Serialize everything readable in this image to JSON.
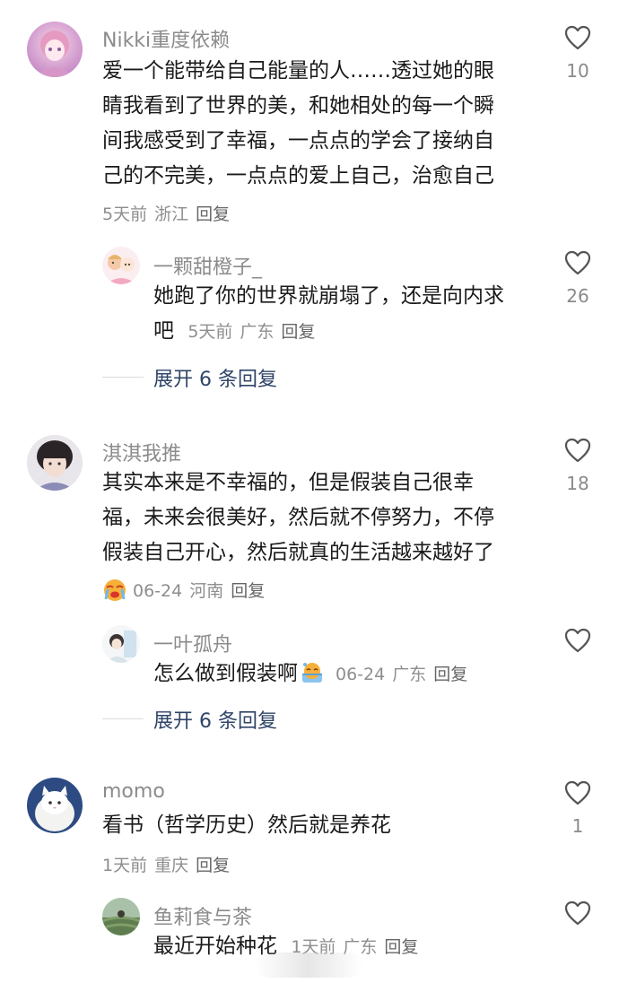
{
  "comments": [
    {
      "username": "Nikki重度依赖",
      "lines": [
        "爱一个能带给自己能量的人……透过她的眼",
        "睛我看到了世界的美，和她相处的每一个瞬",
        "间我感受到了幸福，一点点的学会了接纳自",
        "己的不完美，一点点的爱上自己，治愈自己"
      ],
      "time": "5天前",
      "location": "浙江",
      "reply_label": "回复",
      "likes": "10",
      "reply": {
        "username": "一颗甜橙子_",
        "lines": [
          "她跑了你的世界就崩塌了，还是向内求",
          "吧"
        ],
        "time": "5天前",
        "location": "广东",
        "reply_label": "回复",
        "likes": "26"
      },
      "expand_label": "展开 6 条回复"
    },
    {
      "username": "淇淇我推",
      "lines": [
        "其实本来是不幸福的，但是假装自己很幸",
        "福，未来会很美好，然后就不停努力，不停",
        "假装自己开心，然后就真的生活越来越好了"
      ],
      "time": "06-24",
      "location": "河南",
      "reply_label": "回复",
      "likes": "18",
      "reply": {
        "username": "一叶孤舟",
        "text": "怎么做到假装啊",
        "time": "06-24",
        "location": "广东",
        "reply_label": "回复",
        "likes": ""
      },
      "expand_label": "展开 6 条回复"
    },
    {
      "username": "momo",
      "lines": [
        "看书（哲学历史）然后就是养花"
      ],
      "time": "1天前",
      "location": "重庆",
      "reply_label": "回复",
      "likes": "1",
      "reply": {
        "username": "鱼莉食与茶",
        "text": "最近开始种花",
        "time": "1天前",
        "location": "广东",
        "reply_label": "回复",
        "likes": ""
      }
    }
  ],
  "icons": {
    "like": "heart-outline-icon",
    "emoji_cry": "crying-face-emoji",
    "emoji_sweat": "sweating-face-emoji"
  },
  "colors": {
    "username": "#8b8b8b",
    "text": "#1a1a1a",
    "meta": "#8e8e8e",
    "expand": "#2f4468"
  }
}
